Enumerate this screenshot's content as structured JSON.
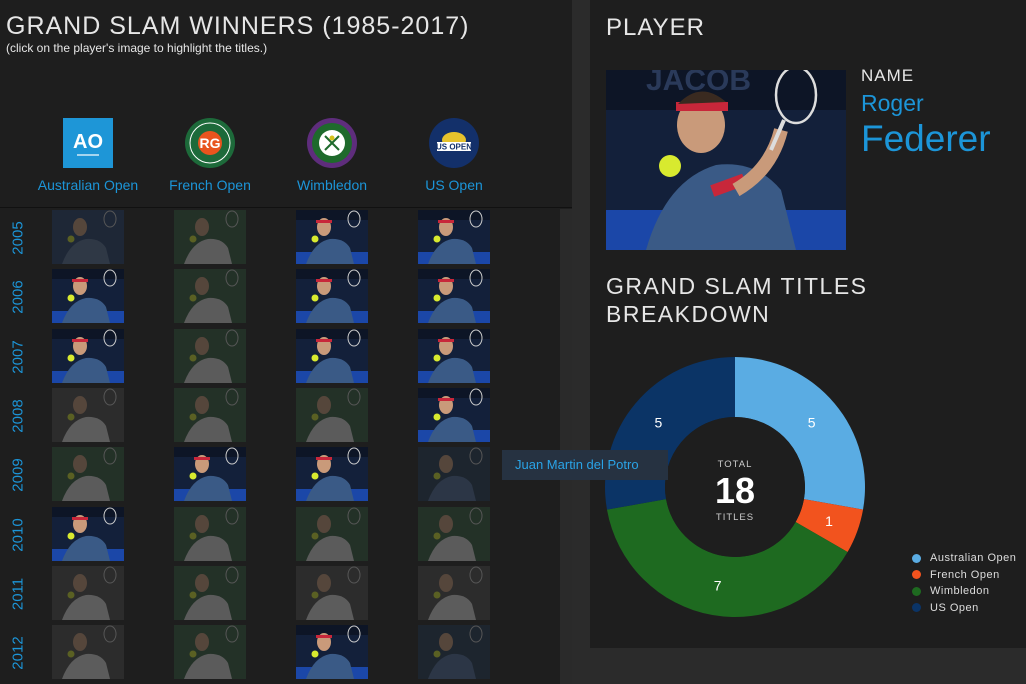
{
  "header": {
    "title": "GRAND SLAM WINNERS (1985-2017)",
    "subtitle": "(click on the player's image to highlight the titles.)"
  },
  "tournaments": [
    {
      "name": "Australian Open",
      "logo_text": "AO",
      "color": "#1e96d7"
    },
    {
      "name": "French Open",
      "logo_text": "ROLAND GARROS",
      "color": "#e8541e"
    },
    {
      "name": "Wimbledon",
      "logo_text": "WIMBLEDON",
      "color": "#5e2d7c"
    },
    {
      "name": "US Open",
      "logo_text": "US OPEN",
      "color": "#1f3e7a"
    }
  ],
  "years": [
    {
      "year": "2005",
      "cells": [
        "other-blue",
        "green",
        "federer",
        "federer"
      ]
    },
    {
      "year": "2006",
      "cells": [
        "federer",
        "green",
        "federer",
        "federer"
      ]
    },
    {
      "year": "2007",
      "cells": [
        "federer",
        "green",
        "federer",
        "federer"
      ]
    },
    {
      "year": "2008",
      "cells": [
        "grey",
        "green",
        "green",
        "federer"
      ]
    },
    {
      "year": "2009",
      "cells": [
        "green",
        "federer",
        "federer",
        "navy"
      ]
    },
    {
      "year": "2010",
      "cells": [
        "federer",
        "green",
        "green",
        "green"
      ]
    },
    {
      "year": "2011",
      "cells": [
        "grey",
        "green",
        "grey",
        "grey"
      ]
    },
    {
      "year": "2012",
      "cells": [
        "grey",
        "green",
        "federer",
        "navy"
      ]
    }
  ],
  "player": {
    "heading": "PLAYER",
    "name_label": "NAME",
    "first_name": "Roger",
    "last_name": "Federer",
    "photo": "player-photo"
  },
  "breakdown": {
    "title": "GRAND SLAM TITLES BREAKDOWN",
    "total_label": "TOTAL",
    "total": "18",
    "unit_label": "TITLES"
  },
  "chart_data": {
    "type": "pie",
    "title": "GRAND SLAM TITLES BREAKDOWN",
    "categories": [
      "Australian Open",
      "French Open",
      "Wimbledon",
      "US Open"
    ],
    "values": [
      5,
      1,
      7,
      5
    ],
    "colors": [
      "#5aace3",
      "#f2531e",
      "#1e6a20",
      "#0b3466"
    ],
    "legend_placement": "bottom-right"
  },
  "tooltip": {
    "text": "Juan Martin del Potro"
  }
}
